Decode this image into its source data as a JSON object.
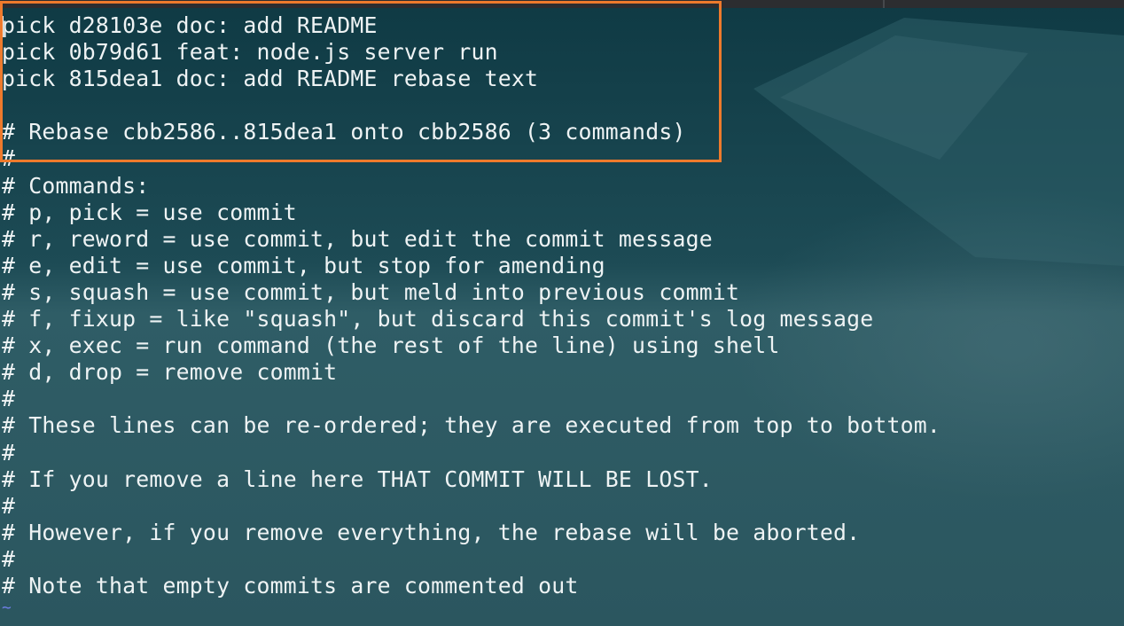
{
  "editor": {
    "lines": [
      "pick d28103e doc: add README",
      "pick 0b79d61 feat: node.js server run",
      "pick 815dea1 doc: add README rebase text",
      "",
      "# Rebase cbb2586..815dea1 onto cbb2586 (3 commands)",
      "#",
      "# Commands:",
      "# p, pick = use commit",
      "# r, reword = use commit, but edit the commit message",
      "# e, edit = use commit, but stop for amending",
      "# s, squash = use commit, but meld into previous commit",
      "# f, fixup = like \"squash\", but discard this commit's log message",
      "# x, exec = run command (the rest of the line) using shell",
      "# d, drop = remove commit",
      "#",
      "# These lines can be re-ordered; they are executed from top to bottom.",
      "#",
      "# If you remove a line here THAT COMMIT WILL BE LOST.",
      "#",
      "# However, if you remove everything, the rebase will be aborted.",
      "#",
      "# Note that empty commits are commented out"
    ],
    "empty_line_marker": "~"
  },
  "colors": {
    "terminal_background": "#224f5a",
    "text": "#eef3f4",
    "tilde": "#6f7fe6",
    "highlight_border": "#ee7a2c"
  }
}
